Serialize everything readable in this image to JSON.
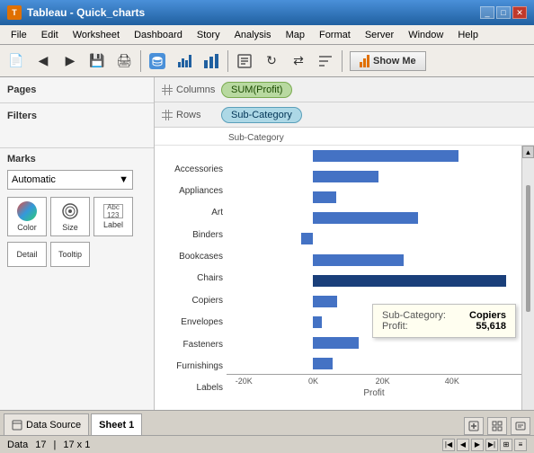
{
  "titleBar": {
    "title": "Tableau - Quick_charts",
    "icon": "T",
    "controls": [
      "_",
      "□",
      "✕"
    ]
  },
  "menuBar": {
    "items": [
      "File",
      "Edit",
      "Worksheet",
      "Dashboard",
      "Story",
      "Analysis",
      "Map",
      "Format",
      "Server",
      "Window",
      "Help"
    ]
  },
  "toolbar": {
    "showMeLabel": "Show Me"
  },
  "shelves": {
    "columnsLabel": "Columns",
    "rowsLabel": "Rows",
    "columnsPill": "SUM(Profit)",
    "rowsPill": "Sub-Category"
  },
  "panels": {
    "pages": "Pages",
    "filters": "Filters",
    "marks": "Marks",
    "marksType": "Automatic",
    "colorLabel": "Color",
    "sizeLabel": "Size",
    "labelLabel": "Label",
    "detailLabel": "Detail",
    "tooltipLabel": "Tooltip"
  },
  "chart": {
    "subCategoryHeader": "Sub-Category",
    "categories": [
      "Accessories",
      "Appliances",
      "Art",
      "Binders",
      "Bookcases",
      "Chairs",
      "Copiers",
      "Envelopes",
      "Fasteners",
      "Furnishings",
      "Labels"
    ],
    "values": [
      41936,
      18838,
      6527,
      30221,
      -3473,
      26122,
      55618,
      6964,
      2384,
      13059,
      5546
    ],
    "xAxisLabels": [
      "-20K",
      "0K",
      "20K",
      "40K"
    ],
    "xAxisTitle": "Profit",
    "xMin": -25000,
    "xMax": 60000
  },
  "tooltip": {
    "subCategoryLabel": "Sub-Category:",
    "subCategoryValue": "Copiers",
    "profitLabel": "Profit:",
    "profitValue": "55,618"
  },
  "tabs": {
    "dataSource": "Data Source",
    "sheet1": "Sheet 1"
  },
  "statusBar": {
    "label": "Data",
    "count": "17",
    "dimensions": "17 x 1"
  }
}
